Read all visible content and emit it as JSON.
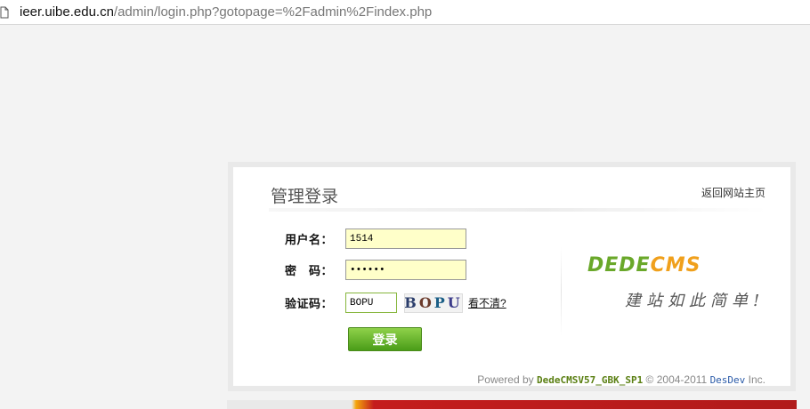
{
  "browser": {
    "url_host": "ieer.uibe.edu.cn",
    "url_path": "/admin/login.php?gotopage=%2Fadmin%2Findex.php"
  },
  "login": {
    "title": "管理登录",
    "back_link": "返回网站主页",
    "username_label": "用户名：",
    "username_value": "1514",
    "password_label": "密　码：",
    "password_value": "••••••",
    "captcha_label": "验证码：",
    "captcha_value": "BOPU",
    "captcha_image_text": [
      "B",
      "O",
      "P",
      "U"
    ],
    "refresh_label": "看不清?",
    "submit_label": "登录"
  },
  "brand": {
    "logo_part1": "DEDE",
    "logo_part2": "CMS",
    "slogan": "建站如此简单!"
  },
  "footer": {
    "prefix": "Powered by",
    "product": "DedeCMSV57_GBK_SP1",
    "copyright": "© 2004-2011",
    "developer": "DesDev",
    "suffix": "Inc."
  },
  "colors": {
    "accent_green": "#4a9d18",
    "input_bg": "#ffffc9",
    "logo_green": "#6aa82a",
    "logo_orange": "#f0a01c"
  }
}
